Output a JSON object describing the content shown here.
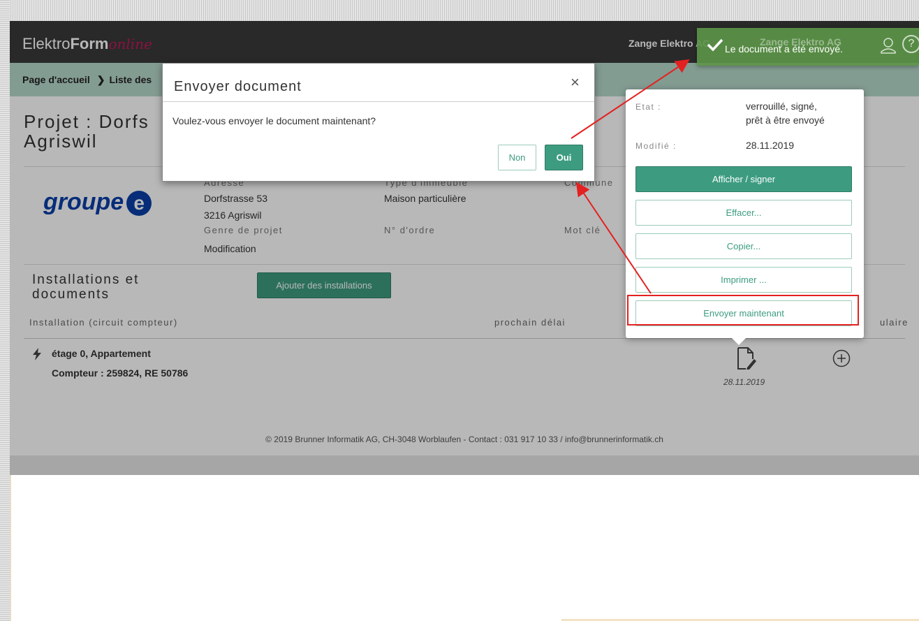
{
  "header": {
    "brand_prefix": "Elektro",
    "brand_bold": "Form",
    "brand_suffix": "online",
    "company": "Zange Elektro AG"
  },
  "breadcrumb": {
    "home": "Page d'accueil",
    "sep": "❯",
    "list": "Liste des"
  },
  "project": {
    "title_line1": "Projet : Dorfs",
    "title_line2": "Agriswil",
    "logo_word": "groupe",
    "logo_letter": "e",
    "fields": {
      "adresse_label": "Adresse",
      "adresse_line1": "Dorfstrasse 53",
      "adresse_line2": "3216 Agriswil",
      "type_label": "Type d'immeuble",
      "type_value": "Maison particulière",
      "commune_label": "Commune",
      "genre_label": "Genre de projet",
      "genre_value": "Modification",
      "ordre_label": "N° d'ordre",
      "motcle_label": "Mot clé"
    }
  },
  "installations": {
    "title_line1": "Installations et",
    "title_line2": "documents",
    "add_button": "Ajouter des installations",
    "col_installation": "Installation (circuit compteur)",
    "col_delai": "prochain délai",
    "col_formulaire": "ulaire",
    "row": {
      "floor": "étage 0, Appartement",
      "meter": "Compteur : 259824, RE 50786",
      "doc_date": "28.11.2019"
    }
  },
  "footer": {
    "text": "© 2019 Brunner Informatik AG, CH-3048 Worblaufen - Contact : 031 917 10 33 / info@brunnerinformatik.ch"
  },
  "doc_panel": {
    "etat_label": "Etat :",
    "etat_line1": "verrouillé, signé,",
    "etat_line2": "prêt à être envoyé",
    "modifie_label": "Modifié :",
    "modifie_value": "28.11.2019",
    "btn_afficher": "Afficher / signer",
    "btn_effacer": "Effacer...",
    "btn_copier": "Copier...",
    "btn_imprimer": "Imprimer ...",
    "btn_envoyer": "Envoyer maintenant"
  },
  "modal": {
    "title": "Envoyer document",
    "close": "×",
    "body": "Voulez-vous envoyer le document maintenant?",
    "no_label": "Non",
    "yes_label": "Oui"
  },
  "toast": {
    "ghost": "Zange Elektro AG",
    "message": "Le document a été envoyé.",
    "help": "?"
  },
  "colors": {
    "accent": "#3d9c80",
    "topbar": "#3a3a3a",
    "breadcrumb_bg": "#b6d8cb",
    "annotation": "#e42121",
    "toast": "#5c9648",
    "brand_online": "#c2185b",
    "logo_blue": "#0b3fa8"
  },
  "icons": {
    "close": "close-icon",
    "check": "check-icon",
    "user": "user-icon",
    "help": "help-icon",
    "bolt": "bolt-icon",
    "document": "document-edit-icon",
    "add": "plus-circle-icon"
  }
}
